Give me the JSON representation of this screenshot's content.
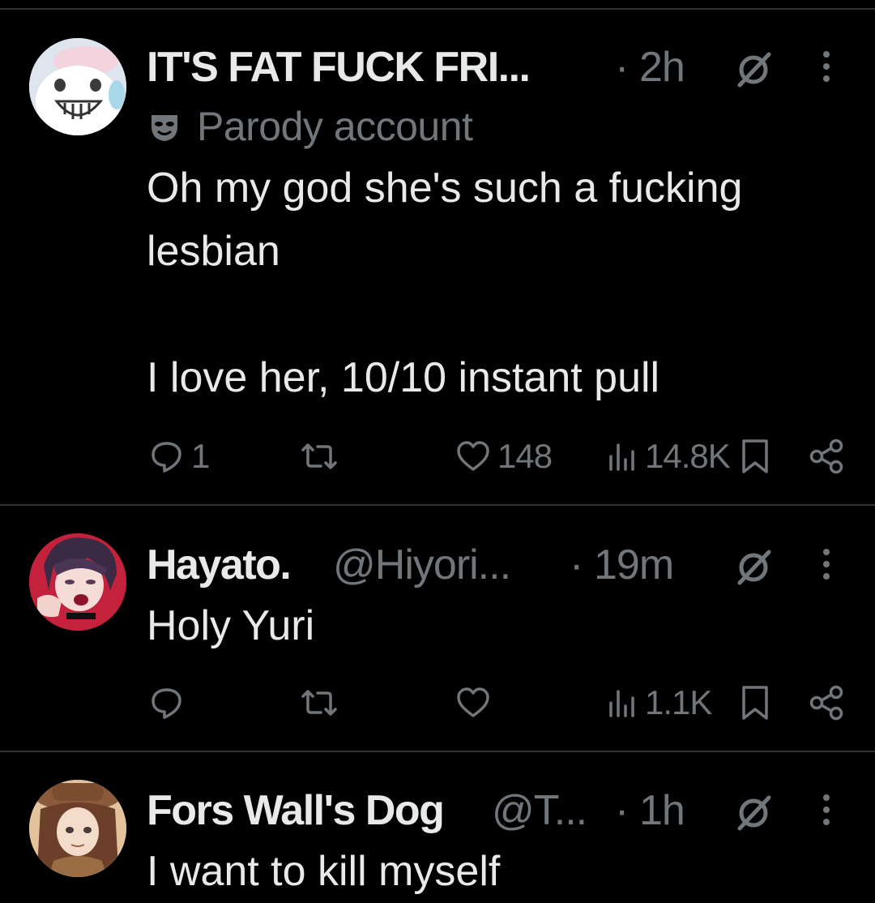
{
  "posts": [
    {
      "name": "IT'S FAT FUCK FRI...",
      "handle": "",
      "separator": "·",
      "time": "2h",
      "badge": "Parody account",
      "text": "Oh my god she's such a fucking\nlesbian\n\nI love her, 10/10 instant pull",
      "replies": "1",
      "reposts": "",
      "likes": "148",
      "views": "14.8K"
    },
    {
      "name": "Hayato.",
      "handle": "@Hiyori...",
      "separator": "·",
      "time": "19m",
      "text": "Holy Yuri",
      "replies": "",
      "reposts": "",
      "likes": "",
      "views": "1.1K"
    },
    {
      "name": "Fors Wall's Dog",
      "handle": "@T...",
      "separator": "·",
      "time": "1h",
      "text": "I want to kill myself"
    }
  ],
  "colors": {
    "background": "#000000",
    "text": "#e7e9ea",
    "muted": "#71767b",
    "divider": "#2f3336"
  }
}
